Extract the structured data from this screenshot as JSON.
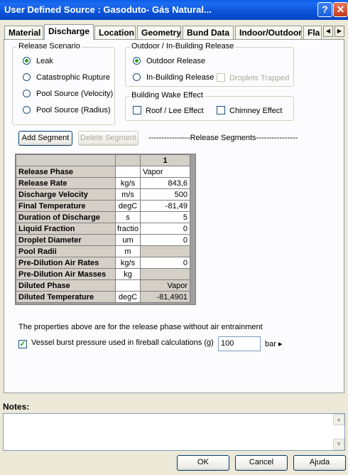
{
  "window": {
    "title": "User Defined Source : Gasoduto- Gás Natural...",
    "help_label": "?",
    "close_label": "✕"
  },
  "tabs": [
    {
      "label": "Material"
    },
    {
      "label": "Discharge"
    },
    {
      "label": "Location"
    },
    {
      "label": "Geometry"
    },
    {
      "label": "Bund Data"
    },
    {
      "label": "Indoor/Outdoor"
    },
    {
      "label": "Fla"
    }
  ],
  "release_scenario": {
    "title": "Release Scenario",
    "options": [
      "Leak",
      "Catastrophic Rupture",
      "Pool Source (Velocity)",
      "Pool Source (Radius)"
    ],
    "selected": "Leak"
  },
  "outdoor_release": {
    "title": "Outdoor / In-Building Release",
    "outdoor_label": "Outdoor Release",
    "inbuilding_label": "In-Building Release",
    "droplets_label": "Droplets Trapped",
    "selected": "Outdoor Release"
  },
  "wake_effect": {
    "title": "Building Wake Effect",
    "roof_label": "Roof / Lee Effect",
    "chimney_label": "Chimney Effect"
  },
  "segments": {
    "add_label": "Add Segment",
    "delete_label": "Delete Segment",
    "caption": "----------------Release Segments----------------"
  },
  "grid": {
    "column_header": "1",
    "rows": [
      {
        "label": "Release Phase",
        "unit": "",
        "value": "Vapor"
      },
      {
        "label": "Release Rate",
        "unit": "kg/s",
        "value": "843,6"
      },
      {
        "label": "Discharge Velocity",
        "unit": "m/s",
        "value": "500"
      },
      {
        "label": "Final Temperature",
        "unit": "degC",
        "value": "-81,49"
      },
      {
        "label": "Duration of Discharge",
        "unit": "s",
        "value": "5"
      },
      {
        "label": "Liquid Fraction",
        "unit": "fractio",
        "value": "0"
      },
      {
        "label": "Droplet Diameter",
        "unit": "um",
        "value": "0"
      },
      {
        "label": "Pool Radii",
        "unit": "m",
        "value": ""
      },
      {
        "label": "Pre-Dilution Air Rates",
        "unit": "kg/s",
        "value": "0"
      },
      {
        "label": "Pre-Dilution Air Masses",
        "unit": "kg",
        "value": ""
      },
      {
        "label": "Diluted Phase",
        "unit": "",
        "value": "Vapor"
      },
      {
        "label": "Diluted Temperature",
        "unit": "degC",
        "value": "-81,4901"
      }
    ]
  },
  "info_text": "The properties above are for the release phase without air entrainment",
  "vessel": {
    "label": "Vessel burst pressure used in fireball calculations (g)",
    "value": "100",
    "unit": "bar ▸",
    "checked": true
  },
  "notes": {
    "label": "Notes:",
    "value": ""
  },
  "buttons": {
    "ok": "OK",
    "cancel": "Cancel",
    "help": "Ajuda"
  }
}
